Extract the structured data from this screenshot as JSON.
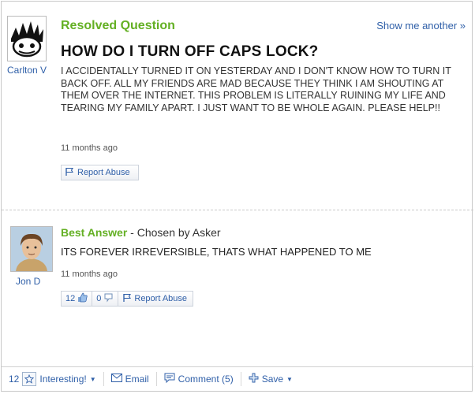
{
  "question": {
    "status": "Resolved Question",
    "show_another": "Show me another »",
    "title": "HOW DO I TURN OFF CAPS LOCK?",
    "body": "I ACCIDENTALLY TURNED IT ON YESTERDAY AND I DON'T KNOW HOW TO TURN IT BACK OFF. ALL MY FRIENDS ARE MAD BECAUSE THEY THINK I AM SHOUTING AT THEM OVER THE INTERNET. THIS PROBLEM IS LITERALLY RUINING MY LIFE AND TEARING MY FAMILY APART. I JUST WANT TO BE WHOLE AGAIN. PLEASE HELP!!",
    "time": "11 months ago",
    "user": "Carlton V",
    "report": "Report Abuse"
  },
  "answer": {
    "label": "Best Answer",
    "chosen": " - Chosen by Asker",
    "body": "ITS FOREVER IRREVERSIBLE, THATS WHAT HAPPENED TO ME",
    "time": "11 months ago",
    "user": "Jon D",
    "thumbs_up": "12",
    "thumbs_down": "0",
    "report": "Report Abuse"
  },
  "footer": {
    "interesting_count": "12",
    "interesting": "Interesting!",
    "email": "Email",
    "comment": "Comment (5)",
    "save": "Save"
  }
}
